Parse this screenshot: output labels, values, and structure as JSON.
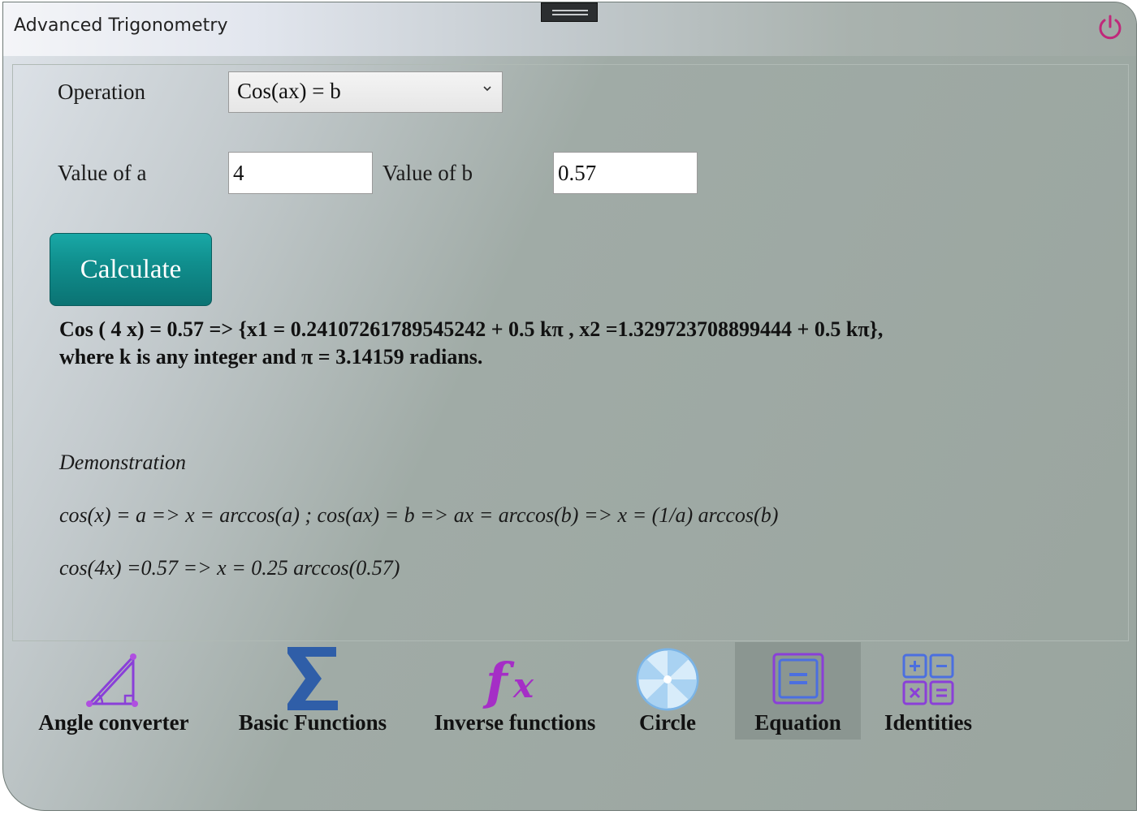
{
  "window": {
    "title": "Advanced Trigonometry"
  },
  "form": {
    "operation_label": "Operation",
    "operation_value": "Cos(ax) = b",
    "a_label": "Value of a",
    "a_value": "4",
    "b_label": "Value of b",
    "b_value": "0.57",
    "calculate_label": "Calculate"
  },
  "result": {
    "line1": "Cos ( 4 x) = 0.57 => {x1 = 0.24107261789545242 + 0.5 kπ , x2 =1.329723708899444 + 0.5 kπ},",
    "line2": "where k is any integer and π = 3.14159 radians."
  },
  "demonstration": {
    "heading": "Demonstration",
    "line1": "cos(x) = a => x = arccos(a) ; cos(ax) = b => ax = arccos(b) => x = (1/a) arccos(b)",
    "line2": "cos(4x) =0.57 => x = 0.25 arccos(0.57)"
  },
  "nav": {
    "items": [
      {
        "label": "Angle converter",
        "icon": "angle-icon"
      },
      {
        "label": "Basic Functions",
        "icon": "sigma-icon"
      },
      {
        "label": "Inverse functions",
        "icon": "fx-icon"
      },
      {
        "label": "Circle",
        "icon": "circle-icon"
      },
      {
        "label": "Equation",
        "icon": "equation-icon",
        "active": true
      },
      {
        "label": "Identities",
        "icon": "calculator-icon"
      }
    ]
  },
  "colors": {
    "accent_teal": "#108f8e",
    "power_magenta": "#c0287a",
    "icon_purple": "#8a3fd8",
    "active_nav_bg": "#8b9691"
  }
}
